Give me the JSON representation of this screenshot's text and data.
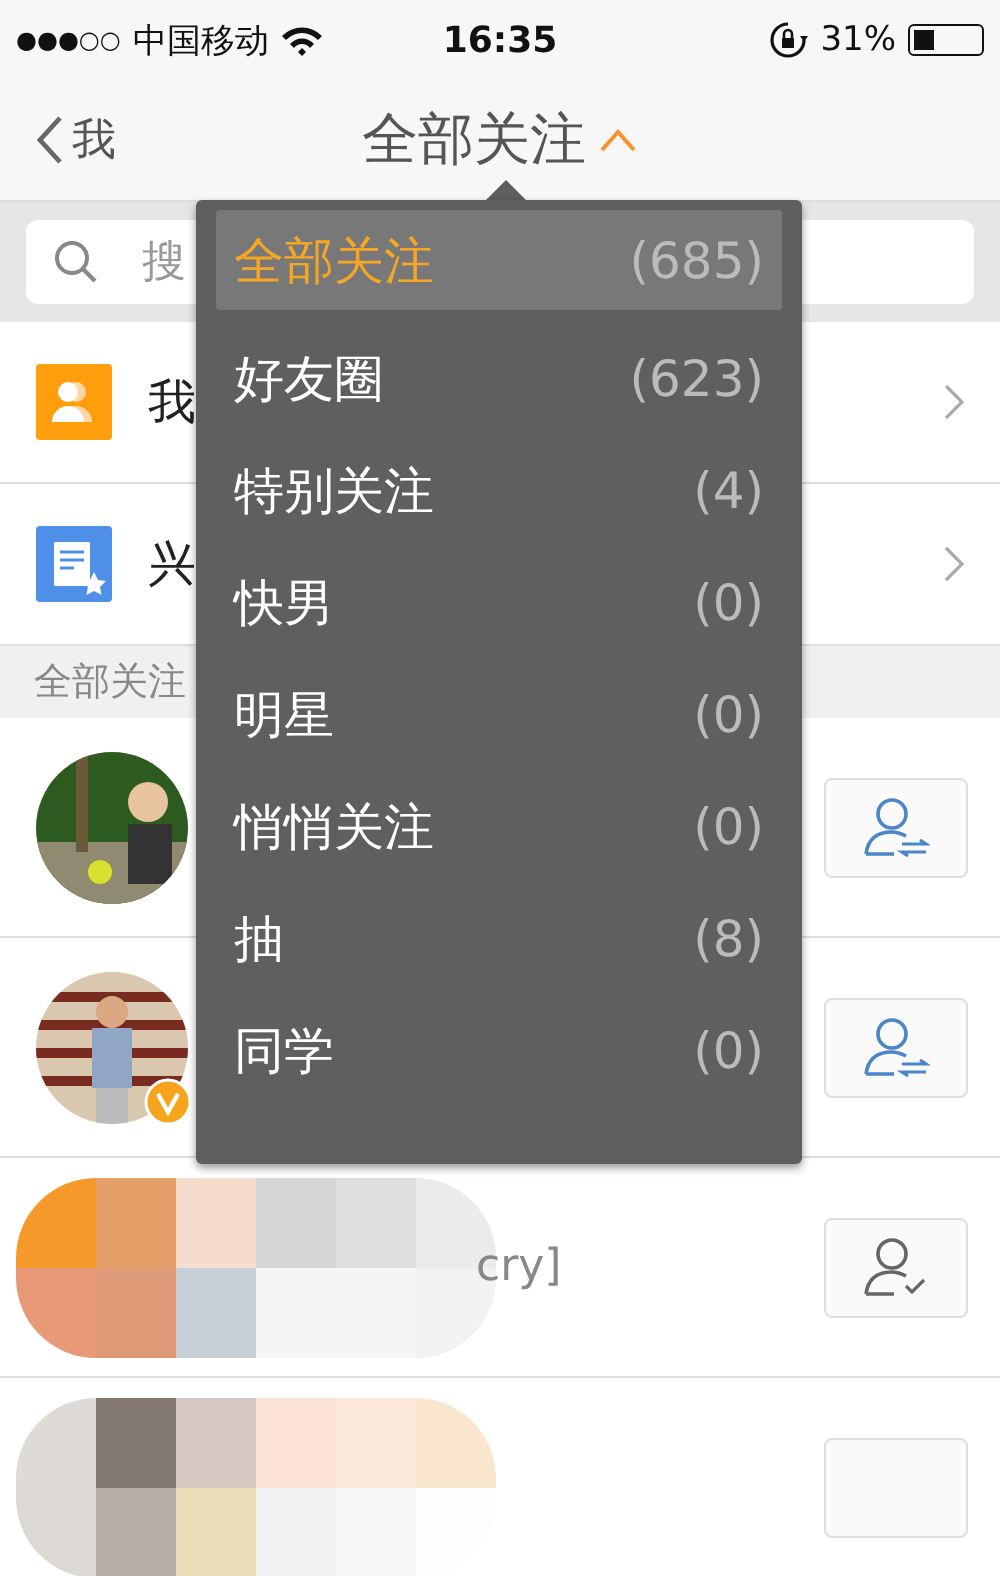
{
  "status_bar": {
    "signal": "●●●○○",
    "carrier": "中国移动",
    "time": "16:35",
    "battery": "31%"
  },
  "nav": {
    "back": "我",
    "title": "全部关注",
    "menu_open": true
  },
  "search": {
    "placeholder": "搜"
  },
  "shortcuts": [
    {
      "kind": "group",
      "label": "我"
    },
    {
      "kind": "page",
      "label": "兴"
    }
  ],
  "section": "全部关注",
  "users": [
    {
      "verified": false,
      "follow_button": {
        "kind": "mutual"
      }
    },
    {
      "verified": true,
      "follow_button": {
        "kind": "mutual"
      }
    },
    {
      "verified": false,
      "text": "cry]",
      "follow_button": {
        "kind": "following"
      }
    },
    {
      "verified": false,
      "follow_button": {
        "kind": "blank"
      }
    }
  ],
  "menu": [
    {
      "label": "全部关注",
      "count": "(685)",
      "selected": true
    },
    {
      "label": "好友圈",
      "count": "(623)",
      "selected": false
    },
    {
      "label": "特别关注",
      "count": "(4)",
      "selected": false
    },
    {
      "label": "快男",
      "count": "(0)",
      "selected": false
    },
    {
      "label": "明星",
      "count": "(0)",
      "selected": false
    },
    {
      "label": "悄悄关注",
      "count": "(0)",
      "selected": false
    },
    {
      "label": "抽",
      "count": "(8)",
      "selected": false
    },
    {
      "label": "同学",
      "count": "(0)",
      "selected": false
    }
  ]
}
